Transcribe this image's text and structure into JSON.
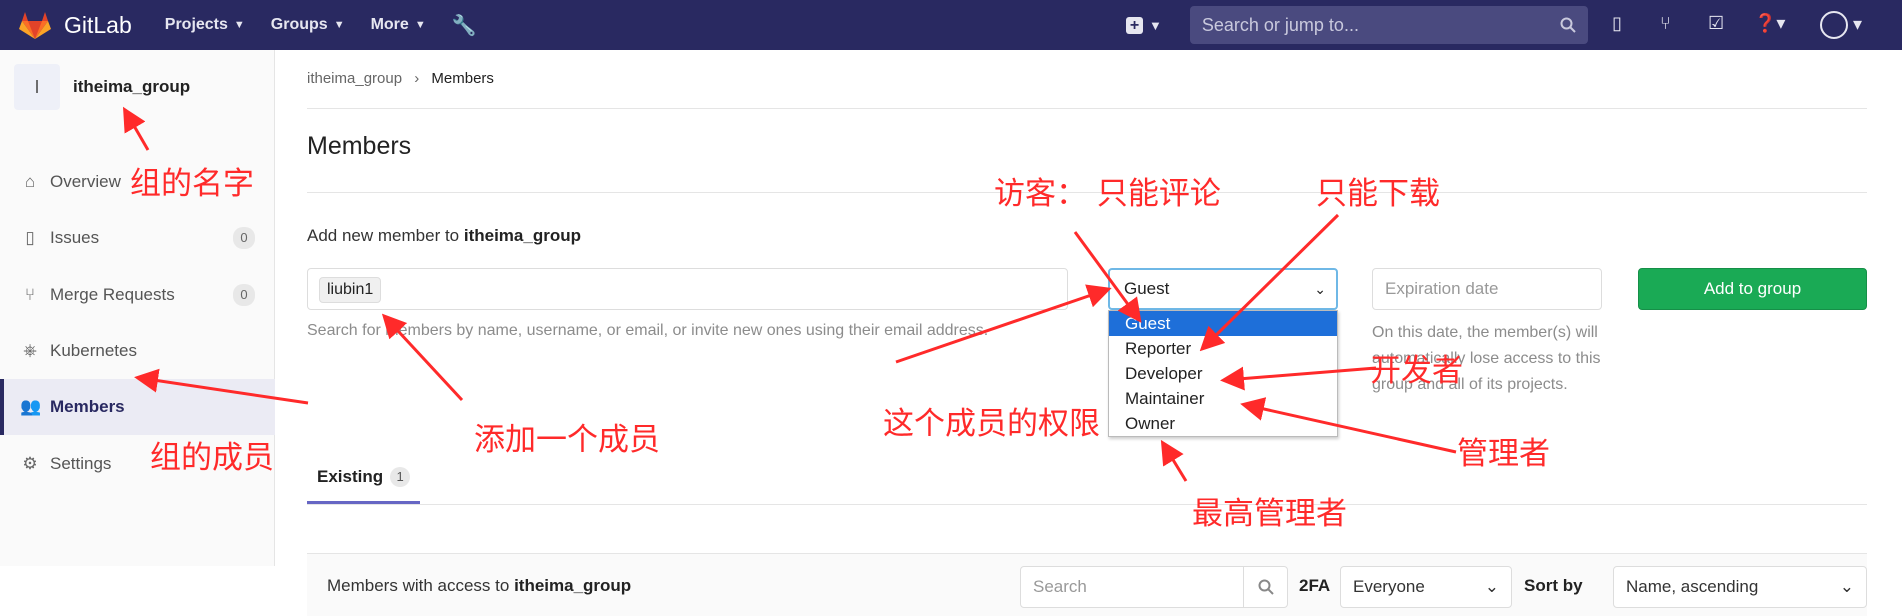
{
  "topbar": {
    "brand": "GitLab",
    "nav": [
      "Projects",
      "Groups",
      "More"
    ],
    "search_placeholder": "Search or jump to..."
  },
  "sidebar": {
    "group_initial": "I",
    "group_name": "itheima_group",
    "items": [
      {
        "label": "Overview",
        "icon": "home-icon"
      },
      {
        "label": "Issues",
        "icon": "issues-icon",
        "count": "0"
      },
      {
        "label": "Merge Requests",
        "icon": "merge-request-icon",
        "count": "0"
      },
      {
        "label": "Kubernetes",
        "icon": "kubernetes-icon"
      },
      {
        "label": "Members",
        "icon": "members-icon",
        "active": true
      },
      {
        "label": "Settings",
        "icon": "gear-icon"
      }
    ]
  },
  "breadcrumb": {
    "group": "itheima_group",
    "current": "Members"
  },
  "page_title": "Members",
  "add_member": {
    "label_prefix": "Add new member to ",
    "group": "itheima_group",
    "token": "liubin1",
    "help": "Search for members by name, username, or email, or invite new ones using their email address.",
    "role_selected": "Guest",
    "role_options": [
      "Guest",
      "Reporter",
      "Developer",
      "Maintainer",
      "Owner"
    ],
    "expiration_placeholder": "Expiration date",
    "expiration_help": "On this date, the member(s) will automatically lose access to this group and all of its projects.",
    "submit": "Add to group"
  },
  "existing": {
    "tab": "Existing",
    "count": "1",
    "label_prefix": "Members with access to ",
    "group": "itheima_group",
    "search_placeholder": "Search",
    "twofa": "2FA",
    "twofa_value": "Everyone",
    "sort_label": "Sort by",
    "sort_value": "Name, ascending"
  },
  "annotations": {
    "group_name": "组的名字",
    "members": "组的成员",
    "add_member": "添加一个成员",
    "guest": "访客： 只能评论",
    "reporter": "只能下载",
    "developer": "开发者",
    "permission": "这个成员的权限",
    "maintainer": "管理者",
    "owner": "最高管理者"
  },
  "colors": {
    "topbar": "#292961",
    "accent": "#1aaa55",
    "annotation": "#ff2a2a",
    "highlight": "#1e6fd9"
  }
}
